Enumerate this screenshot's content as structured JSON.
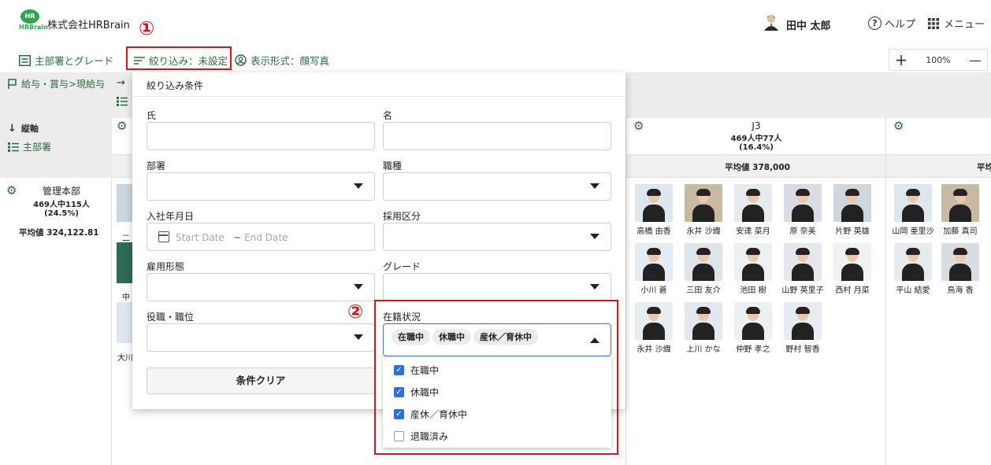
{
  "header": {
    "logo_text_top": "HR",
    "logo_text_bottom": "HRBrain",
    "company": "株式会社HRBrain",
    "callout1": "①",
    "user_name": "田中 太郎",
    "help_label": "ヘルプ",
    "menu_label": "メニュー"
  },
  "toolbar": {
    "dept_grade": "主部署とグレード",
    "filter": "絞り込み：未設定",
    "display": "表示形式：顔写真",
    "zoom": "100%",
    "zoom_in": "+",
    "zoom_out": "—"
  },
  "left": {
    "breadcrumb": "給与・賞与>現給与",
    "arrow": "→",
    "vertical_axis": "縦軸",
    "main_dept": "主部署",
    "dept_name": "管理本部",
    "dept_count": "469人中115人",
    "dept_pct": "(24.5%)",
    "dept_avg": "平均値 324,122.81"
  },
  "column_j3": {
    "grade": "J3",
    "count": "469人中77人",
    "pct": "(16.4%)",
    "avg": "平均値 378,000"
  },
  "column_next": {
    "avg_partial": "平均"
  },
  "partial_names": [
    "二",
    "中",
    "大川"
  ],
  "people_j3": [
    [
      "高橋 由香",
      "永井 沙織",
      "安達 菜月",
      "原 奈美",
      "片野 英雄"
    ],
    [
      "小川 蒼",
      "三田 友介",
      "池田 樹",
      "山野 英里子",
      "西村 月菜"
    ],
    [
      "永井 沙織",
      "上川 かな",
      "仲野 孝之",
      "野村 智香"
    ]
  ],
  "people_next": [
    [
      "山岡 亜里沙",
      "加藤 真司"
    ],
    [
      "平山 結愛",
      "鳥海 香"
    ]
  ],
  "filter_panel": {
    "title": "絞り込み条件",
    "last_name": "氏",
    "first_name": "名",
    "department": "部署",
    "job_type": "職種",
    "hire_date": "入社年月日",
    "start_date": "Start Date",
    "tilde": "~",
    "end_date": "End Date",
    "hiring_category": "採用区分",
    "employment_type": "雇用形態",
    "grade": "グレード",
    "position": "役職・職位",
    "status": "在籍状況",
    "clear": "条件クリア",
    "callout2": "②",
    "chips": [
      "在職中",
      "休職中",
      "産休／育休中"
    ],
    "options": [
      {
        "label": "在職中",
        "checked": true
      },
      {
        "label": "休職中",
        "checked": true
      },
      {
        "label": "産休／育休中",
        "checked": true
      },
      {
        "label": "退職済み",
        "checked": false
      }
    ]
  },
  "colors": {
    "brand_green": "#2aa84a",
    "text_green": "#2a6a42",
    "highlight_red": "#e0101a",
    "checkbox_blue": "#2f6fd6"
  }
}
